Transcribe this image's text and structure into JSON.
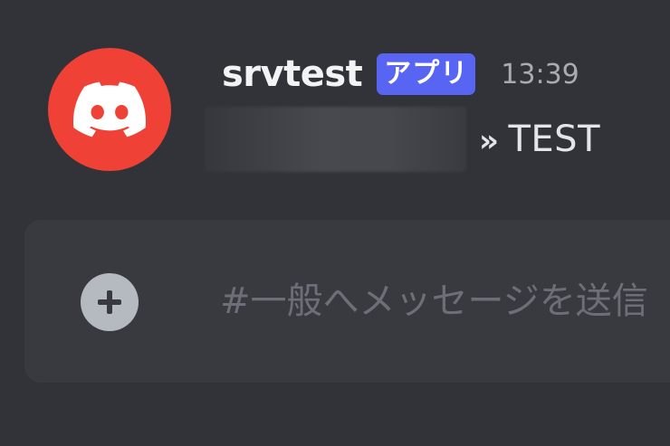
{
  "message": {
    "author": {
      "username": "srvtest",
      "badge": "アプリ"
    },
    "timestamp": "13:39",
    "content": {
      "arrow": "»",
      "text": "TEST"
    },
    "avatar_icon": "discord-logo-icon"
  },
  "composer": {
    "placeholder": "#一般へメッセージを送信",
    "add_icon": "plus-icon"
  },
  "colors": {
    "background": "#313338",
    "composer_background": "#383a40",
    "avatar": "#ef4136",
    "badge": "#5865f2",
    "username": "#f2f3f5",
    "timestamp": "#a9abb1",
    "placeholder": "#6d6f78"
  }
}
